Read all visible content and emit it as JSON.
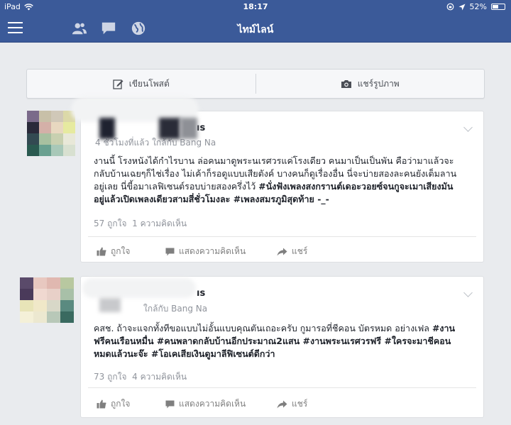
{
  "status_bar": {
    "device": "iPad",
    "time": "18:17",
    "battery": "52%",
    "battery_level": 0.52
  },
  "nav": {
    "title": "ไทม์ไลน์",
    "icons": [
      "menu-icon",
      "friends-icon",
      "messages-icon",
      "globe-icon"
    ]
  },
  "composer": {
    "write_label": "เขียนโพสต์",
    "photo_label": "แชร์รูปภาพ"
  },
  "posts": [
    {
      "author_suffix": "ıs",
      "meta": "4 ชั่วโมงที่แล้ว ใกล้กับ Bang Na",
      "text": "งานนี้ โรงหนังได้กำไรบาน ล่อคนมาดูพระนเรศวรแค่โรงเดียว คนมาเป็นเป็นพัน คือว่ามาแล้วจะกลับบ้านเฉยๆก็ไช่เรื่อง ไม่เค้าก็รอดูแบบเสียตังค์ บางคนก็ดูเรื่องอื่น นี่จะบ่ายสองละคนยังเต็มลานอยู่เลย นี่ขี้อมาเลฟิเซนต์รอบบ่ายสองครึ่งไว้ ",
      "tags": "#นั่งฟังเพลงสงกรานต์เดอะวอยซ์จนกูจะเมาเสียงมันอยู่แล้วเปิดเพลงเดียวสามสี่ชั่วโมงละ  #เพลงสมรภูมิสุดท้าย -_-",
      "likes": "57 ถูกใจ",
      "comments": "1 ความคิดเห็น",
      "like_label": "ถูกใจ",
      "comment_label": "แสดงความคิดเห็น",
      "share_label": "แชร์"
    },
    {
      "author_suffix": "ıs",
      "meta": "ใกล้กับ Bang Na",
      "text": "คสช. ถ้าจะแจกทั้งทีขอแบบไม่อั้นแบบคุณตันเถอะครับ กูมารอที่ชีคอน บัตรหมด อย่างเฟล ",
      "tags": "#งานฟรีคนเรือนหมื่น #คนพลาดกลับบ้านอีกประมาณ2แสน #งานพระนเรศวรฟรี #ใครจะมาชีคอนหมดแล้วนะจ๊ะ  #โอเคเสียเงินดูมาลีฟิเซนต์ดีกว่า",
      "likes": "73 ถูกใจ",
      "comments": "4 ความคิดเห็น",
      "like_label": "ถูกใจ",
      "comment_label": "แสดงความคิดเห็น",
      "share_label": "แชร์"
    }
  ],
  "colors": {
    "brand": "#3b5a99",
    "background": "#e9ebee",
    "card": "#ffffff"
  }
}
